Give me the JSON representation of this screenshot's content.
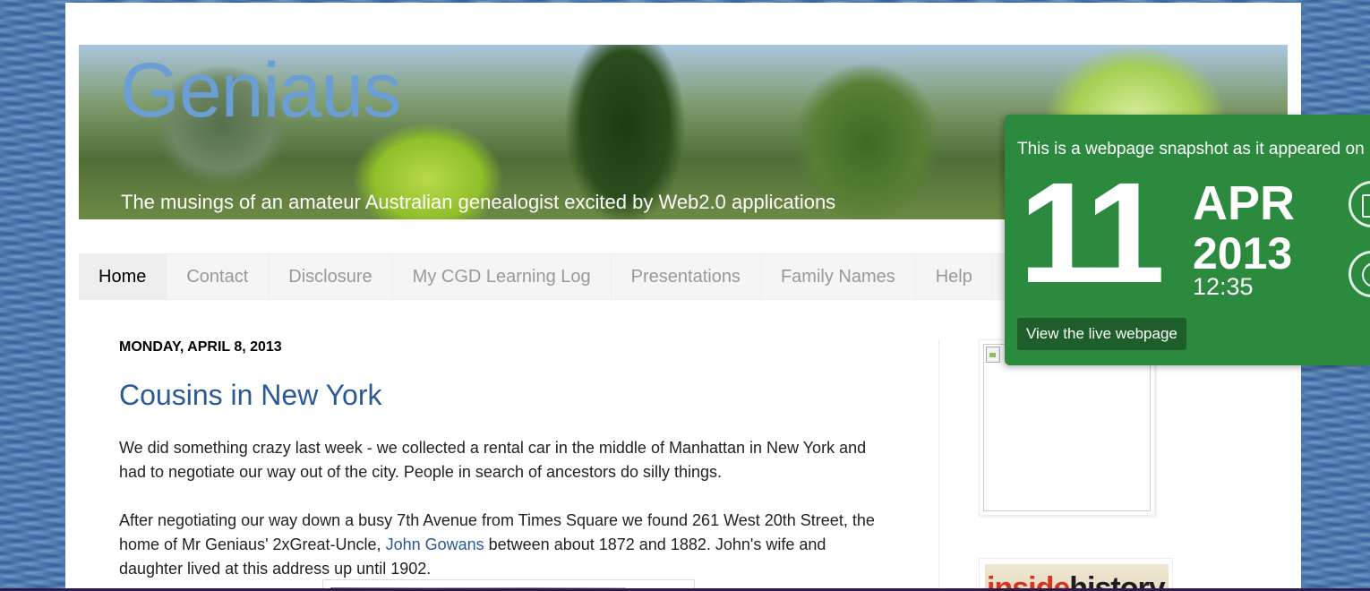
{
  "blog": {
    "title": "Geniaus",
    "description": "The musings of an amateur Australian genealogist excited by Web2.0 applications"
  },
  "tabs": [
    {
      "label": "Home",
      "active": true
    },
    {
      "label": "Contact",
      "active": false
    },
    {
      "label": "Disclosure",
      "active": false
    },
    {
      "label": "My CGD Learning Log",
      "active": false
    },
    {
      "label": "Presentations",
      "active": false
    },
    {
      "label": "Family Names",
      "active": false
    },
    {
      "label": "Help",
      "active": false
    }
  ],
  "post": {
    "date": "MONDAY, APRIL 8, 2013",
    "title": "Cousins in New York",
    "paragraph1": "We did something crazy last week - we collected a rental car in the middle of Manhattan in New York and had to negotiate our way out of the city. People in search of ancestors do silly things.",
    "paragraph2_before": "After negotiating our way down a busy 7th Avenue from Times Square we found 261 West 20th Street, the home of Mr Geniaus' 2xGreat-Uncle, ",
    "paragraph2_link": "John Gowans",
    "paragraph2_after": " between about 1872 and 1882. John's wife and daughter lived at this address up until 1902."
  },
  "sidebar": {
    "logo_part1": "inside",
    "logo_part2": "history"
  },
  "snapshot": {
    "intro": "This is a webpage snapshot as it appeared on",
    "day": "11",
    "month": "APR",
    "year": "2013",
    "time": "12:35",
    "button_label": "View the live webpage"
  },
  "colors": {
    "overlay_green": "#2b8a3e",
    "link_blue": "#2a5a96",
    "title_blue": "#6a9ed4"
  }
}
